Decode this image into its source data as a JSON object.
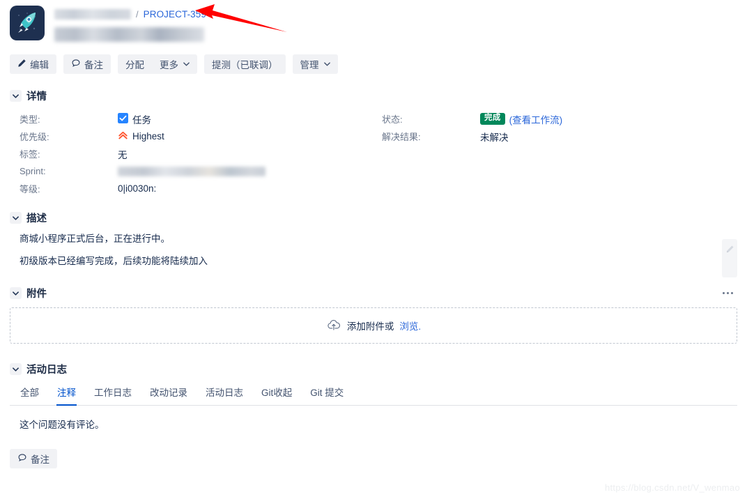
{
  "header": {
    "logo_icon": "rocket-icon",
    "breadcrumb_project_blurred": "",
    "breadcrumb_separator": "/",
    "issue_key": "PROJECT-359",
    "title_blurred": ""
  },
  "toolbar": {
    "edit_label": "编辑",
    "comment_label": "备注",
    "assign_label": "分配",
    "more_label": "更多",
    "workflow_label": "提测（已联调）",
    "manage_label": "管理",
    "caret": "⌄"
  },
  "details": {
    "section_title": "详情",
    "left_fields": [
      {
        "label": "类型:",
        "value": "任务",
        "icon": "task-checkbox-icon"
      },
      {
        "label": "优先级:",
        "value": "Highest",
        "icon": "priority-highest-icon"
      },
      {
        "label": "标签:",
        "value": "无",
        "icon": ""
      },
      {
        "label": "Sprint:",
        "value": "",
        "icon": ""
      },
      {
        "label": "等级:",
        "value": "0|i0030n:",
        "icon": ""
      }
    ],
    "right_fields": [
      {
        "label": "状态:",
        "badge": "完成",
        "link": "(查看工作流)"
      },
      {
        "label": "解决结果:",
        "value": "未解决"
      }
    ]
  },
  "description": {
    "section_title": "描述",
    "paragraphs": [
      "商城小程序正式后台，正在进行中。",
      "初级版本已经编写完成，后续功能将陆续加入"
    ],
    "edit_icon": "pencil-icon"
  },
  "attachments": {
    "section_title": "附件",
    "menu_icon": "more-options-icon",
    "dropzone_icon": "cloud-upload-icon",
    "dropzone_text": "添加附件或",
    "dropzone_link": "浏览."
  },
  "activity": {
    "section_title": "活动日志",
    "tabs": [
      {
        "label": "全部",
        "active": false
      },
      {
        "label": "注释",
        "active": true
      },
      {
        "label": "工作日志",
        "active": false
      },
      {
        "label": "改动记录",
        "active": false
      },
      {
        "label": "活动日志",
        "active": false
      },
      {
        "label": "Git收起",
        "active": false
      },
      {
        "label": "Git 提交",
        "active": false
      }
    ],
    "empty_text": "这个问题没有评论。"
  },
  "bottom": {
    "comment_label": "备注"
  },
  "watermark": "https://blog.csdn.net/V_wenmao",
  "colors": {
    "accent_blue": "#0052CC",
    "link_blue": "#2a66d9",
    "status_green": "#00875A",
    "priority_orange": "#FF5630",
    "label_gray": "#6B778C",
    "text_dark": "#172B4D",
    "annotation_red": "#FF0000"
  }
}
